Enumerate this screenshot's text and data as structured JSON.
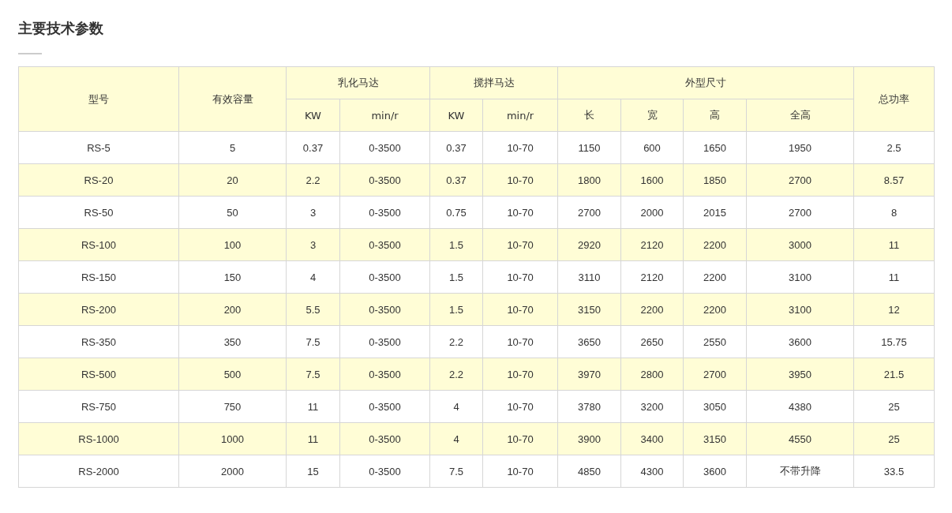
{
  "title": "主要技术参数",
  "table": {
    "header_top": [
      {
        "label": "型号",
        "rowspan": 2
      },
      {
        "label": "有效容量",
        "rowspan": 2
      },
      {
        "label": "乳化马达",
        "colspan": 2
      },
      {
        "label": "搅拌马达",
        "colspan": 2
      },
      {
        "label": "外型尺寸",
        "colspan": 4
      },
      {
        "label": "总功率",
        "rowspan": 2
      }
    ],
    "header_sub": [
      "KW",
      "min/r",
      "KW",
      "min/r",
      "长",
      "宽",
      "高",
      "全高"
    ],
    "rows": [
      {
        "highlighted": false,
        "cells": [
          "RS-5",
          "5",
          "0.37",
          "0-3500",
          "0.37",
          "10-70",
          "1150",
          "600",
          "1650",
          "1950",
          "2.5"
        ]
      },
      {
        "highlighted": true,
        "cells": [
          "RS-20",
          "20",
          "2.2",
          "0-3500",
          "0.37",
          "10-70",
          "1800",
          "1600",
          "1850",
          "2700",
          "8.57"
        ]
      },
      {
        "highlighted": false,
        "cells": [
          "RS-50",
          "50",
          "3",
          "0-3500",
          "0.75",
          "10-70",
          "2700",
          "2000",
          "2015",
          "2700",
          "8"
        ]
      },
      {
        "highlighted": true,
        "cells": [
          "RS-100",
          "100",
          "3",
          "0-3500",
          "1.5",
          "10-70",
          "2920",
          "2120",
          "2200",
          "3000",
          "11"
        ]
      },
      {
        "highlighted": false,
        "cells": [
          "RS-150",
          "150",
          "4",
          "0-3500",
          "1.5",
          "10-70",
          "3110",
          "2120",
          "2200",
          "3100",
          "11"
        ]
      },
      {
        "highlighted": true,
        "cells": [
          "RS-200",
          "200",
          "5.5",
          "0-3500",
          "1.5",
          "10-70",
          "3150",
          "2200",
          "2200",
          "3100",
          "12"
        ]
      },
      {
        "highlighted": false,
        "cells": [
          "RS-350",
          "350",
          "7.5",
          "0-3500",
          "2.2",
          "10-70",
          "3650",
          "2650",
          "2550",
          "3600",
          "15.75"
        ]
      },
      {
        "highlighted": true,
        "cells": [
          "RS-500",
          "500",
          "7.5",
          "0-3500",
          "2.2",
          "10-70",
          "3970",
          "2800",
          "2700",
          "3950",
          "21.5"
        ]
      },
      {
        "highlighted": false,
        "cells": [
          "RS-750",
          "750",
          "11",
          "0-3500",
          "4",
          "10-70",
          "3780",
          "3200",
          "3050",
          "4380",
          "25"
        ]
      },
      {
        "highlighted": true,
        "cells": [
          "RS-1000",
          "1000",
          "11",
          "0-3500",
          "4",
          "10-70",
          "3900",
          "3400",
          "3150",
          "4550",
          "25"
        ]
      },
      {
        "highlighted": false,
        "cells": [
          "RS-2000",
          "2000",
          "15",
          "0-3500",
          "7.5",
          "10-70",
          "4850",
          "4300",
          "3600",
          "不带升降",
          "33.5"
        ]
      }
    ]
  }
}
